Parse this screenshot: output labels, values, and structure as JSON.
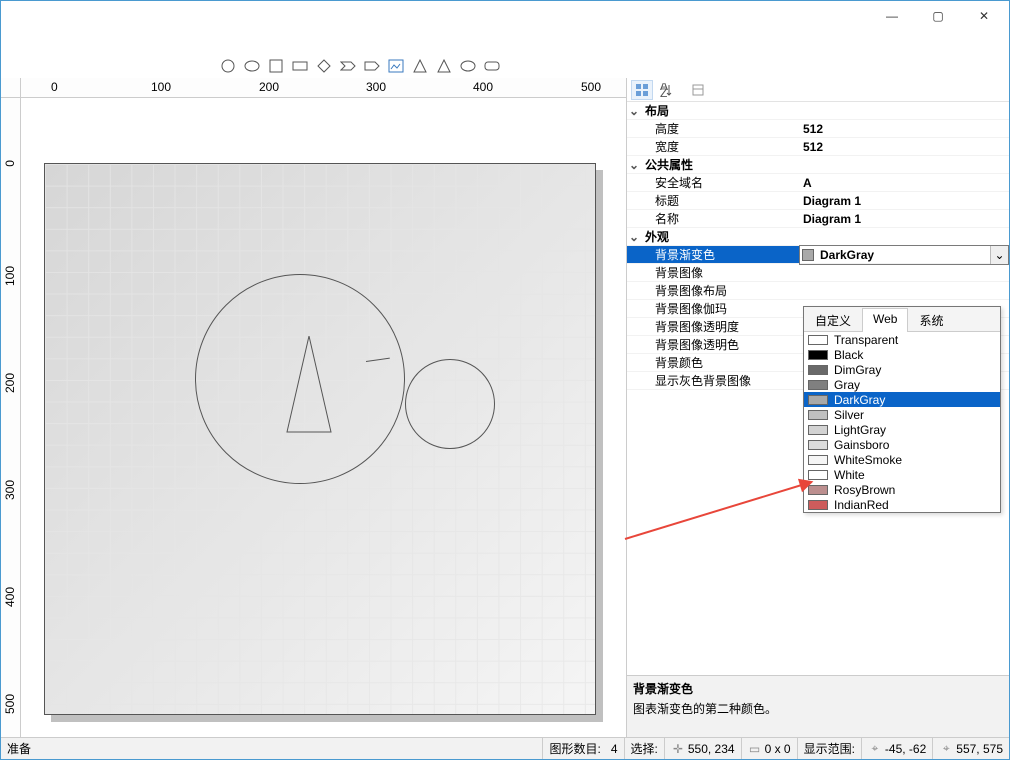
{
  "titlebar": {
    "minimize": "—",
    "maximize": "▢",
    "close": "✕"
  },
  "toolbar_shapes": [
    "circle",
    "ellipse",
    "square",
    "rect",
    "diamond",
    "chevron",
    "pentagon",
    "image",
    "triangle",
    "triangle2",
    "ellipse2",
    "roundrect"
  ],
  "ruler_top": [
    "0",
    "100",
    "200",
    "300",
    "400",
    "500"
  ],
  "ruler_left": [
    "0",
    "100",
    "200",
    "300",
    "400",
    "500"
  ],
  "prop_toolbar": {
    "view1": "categorized-icon",
    "view2": "alpha-sort-icon",
    "view3": "prop-pages-icon"
  },
  "properties": {
    "layout": {
      "label": "布局",
      "items": [
        {
          "label": "高度",
          "value": "512"
        },
        {
          "label": "宽度",
          "value": "512"
        }
      ]
    },
    "public": {
      "label": "公共属性",
      "items": [
        {
          "label": "安全域名",
          "value": "A"
        },
        {
          "label": "标题",
          "value": "Diagram 1"
        },
        {
          "label": "名称",
          "value": "Diagram 1"
        }
      ]
    },
    "appearance": {
      "label": "外观",
      "items": [
        {
          "label": "背景渐变色",
          "value": "DarkGray",
          "selected": true,
          "color": "#a9a9a9"
        },
        {
          "label": "背景图像",
          "value": ""
        },
        {
          "label": "背景图像布局",
          "value": ""
        },
        {
          "label": "背景图像伽玛",
          "value": ""
        },
        {
          "label": "背景图像透明度",
          "value": ""
        },
        {
          "label": "背景图像透明色",
          "value": ""
        },
        {
          "label": "背景颜色",
          "value": ""
        },
        {
          "label": "显示灰色背景图像",
          "value": ""
        }
      ]
    }
  },
  "color_popup": {
    "tabs": [
      "自定义",
      "Web",
      "系统"
    ],
    "active_tab": 1,
    "colors": [
      {
        "name": "Transparent",
        "hex": "#ffffff"
      },
      {
        "name": "Black",
        "hex": "#000000"
      },
      {
        "name": "DimGray",
        "hex": "#696969"
      },
      {
        "name": "Gray",
        "hex": "#808080"
      },
      {
        "name": "DarkGray",
        "hex": "#a9a9a9",
        "selected": true
      },
      {
        "name": "Silver",
        "hex": "#c0c0c0"
      },
      {
        "name": "LightGray",
        "hex": "#d3d3d3"
      },
      {
        "name": "Gainsboro",
        "hex": "#dcdcdc"
      },
      {
        "name": "WhiteSmoke",
        "hex": "#f5f5f5"
      },
      {
        "name": "White",
        "hex": "#ffffff"
      },
      {
        "name": "RosyBrown",
        "hex": "#bc8f8f"
      },
      {
        "name": "IndianRed",
        "hex": "#cd5c5c"
      }
    ]
  },
  "help": {
    "title": "背景渐变色",
    "desc": "图表渐变色的第二种颜色。"
  },
  "status": {
    "ready": "准备",
    "shape_count_label": "图形数目:",
    "shape_count_value": "4",
    "select_label": "选择:",
    "cursor": "550, 234",
    "size": "0 x 0",
    "range_label": "显示范围:",
    "range_from": "-45, -62",
    "range_to": "557, 575"
  }
}
